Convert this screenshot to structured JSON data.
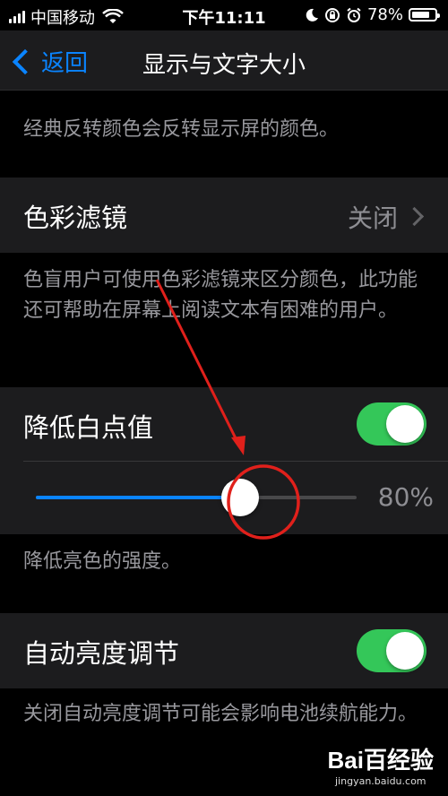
{
  "status_bar": {
    "carrier": "中国移动",
    "time": "下午11:11",
    "battery": "78%",
    "battery_level": 0.78,
    "icons": [
      "signal-icon",
      "wifi-icon",
      "moon-icon",
      "orientation-lock-icon",
      "alarm-icon",
      "battery-icon"
    ]
  },
  "nav": {
    "back_label": "返回",
    "title": "显示与文字大小"
  },
  "sections": {
    "invert_footer": "经典反转颜色会反转显示屏的颜色。",
    "color_filters": {
      "label": "色彩滤镜",
      "value": "关闭",
      "footer": "色盲用户可使用色彩滤镜来区分颜色，此功能还可帮助在屏幕上阅读文本有困难的用户。"
    },
    "reduce_white_point": {
      "label": "降低白点值",
      "enabled": true,
      "slider_fraction": 0.8,
      "slider_value": "80%",
      "footer": "降低亮色的强度。"
    },
    "auto_brightness": {
      "label": "自动亮度调节",
      "enabled": true,
      "footer": "关闭自动亮度调节可能会影响电池续航能力。"
    }
  },
  "watermark": {
    "brand": "Bai百经验",
    "url": "jingyan.baidu.com"
  },
  "colors": {
    "accent": "#0a84ff",
    "switch_on": "#34c759",
    "annotation": "#e0201b",
    "cell_bg": "#1c1c1e"
  }
}
